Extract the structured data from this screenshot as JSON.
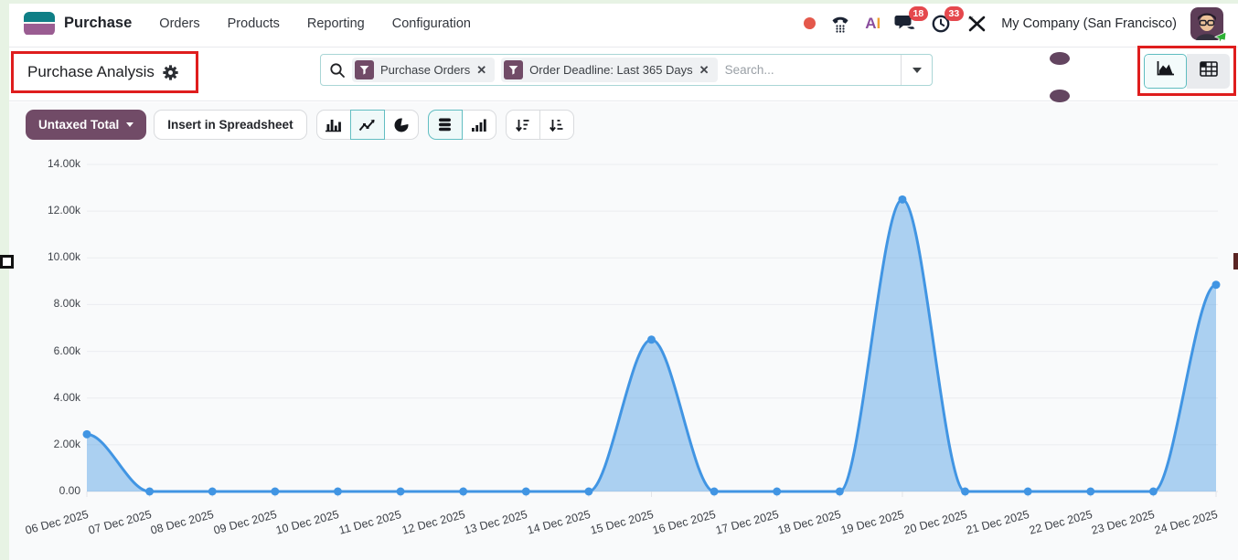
{
  "colors": {
    "accent_purple": "#714b67",
    "accent_teal": "#62bec2",
    "annotation_red": "#df1d1d",
    "badge_red": "#e5484d",
    "chart_line": "#4195e3",
    "chart_fill": "rgba(65,149,227,0.42)",
    "content_bg": "#f9fafb"
  },
  "icons": [
    "purchase-app-icon",
    "record-indicator-icon",
    "phone-icon",
    "ai-logo-icon",
    "chat-icon",
    "clock-icon",
    "tools-icon",
    "plane-status-icon",
    "gear-icon",
    "search-icon",
    "filter-funnel-icon",
    "clear-filter-icon",
    "dropdown-caret-icon",
    "bar-chart-icon",
    "line-chart-icon",
    "pie-chart-icon",
    "stacked-icon",
    "cumulative-icon",
    "sort-desc-icon",
    "sort-asc-icon",
    "area-view-icon",
    "pivot-view-icon"
  ],
  "topbar": {
    "app_name": "Purchase",
    "menu": [
      "Orders",
      "Products",
      "Reporting",
      "Configuration"
    ],
    "company": "My Company (San Francisco)",
    "badges": {
      "messages": "18",
      "activities": "33"
    }
  },
  "control_panel": {
    "title": "Purchase Analysis",
    "search": {
      "placeholder": "Search...",
      "filters": [
        {
          "label": "Purchase Orders"
        },
        {
          "label": "Order Deadline: Last 365 Days"
        }
      ]
    }
  },
  "toolbar": {
    "measure": "Untaxed Total",
    "spreadsheet": "Insert in Spreadsheet"
  },
  "chart_data": {
    "type": "area",
    "title": "",
    "xlabel": "",
    "ylabel": "",
    "x": [
      "06 Dec 2025",
      "07 Dec 2025",
      "08 Dec 2025",
      "09 Dec 2025",
      "10 Dec 2025",
      "11 Dec 2025",
      "12 Dec 2025",
      "13 Dec 2025",
      "14 Dec 2025",
      "15 Dec 2025",
      "16 Dec 2025",
      "17 Dec 2025",
      "18 Dec 2025",
      "19 Dec 2025",
      "20 Dec 2025",
      "21 Dec 2025",
      "22 Dec 2025",
      "23 Dec 2025",
      "24 Dec 2025"
    ],
    "series": [
      {
        "name": "Untaxed Total",
        "values": [
          2450,
          0,
          0,
          0,
          0,
          0,
          0,
          0,
          0,
          6500,
          0,
          0,
          0,
          12500,
          0,
          0,
          0,
          0,
          8850
        ]
      }
    ],
    "ylim": [
      0,
      14000
    ],
    "y_ticks": [
      0,
      2000,
      4000,
      6000,
      8000,
      10000,
      12000,
      14000
    ],
    "y_tick_labels": [
      "0.00",
      "2.00k",
      "4.00k",
      "6.00k",
      "8.00k",
      "10.00k",
      "12.00k",
      "14.00k"
    ],
    "grid": true,
    "legend": "none",
    "smooth": true
  }
}
